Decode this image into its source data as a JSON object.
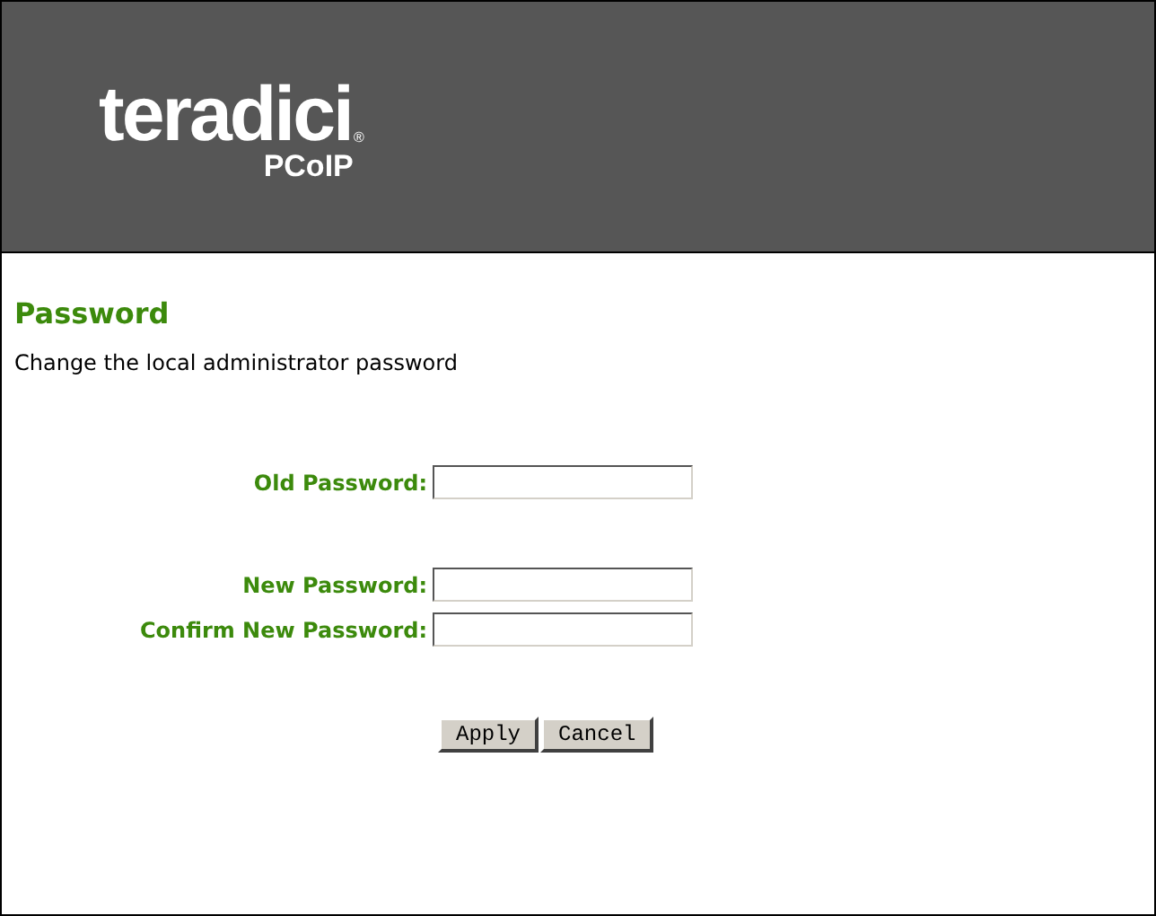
{
  "header": {
    "logo": {
      "brand": "teradici",
      "mark": "®",
      "product": "PCoIP"
    }
  },
  "page": {
    "title": "Password",
    "description": "Change the local administrator password"
  },
  "field_groups": [
    [
      {
        "label": "Old Password:"
      }
    ],
    [
      {
        "label": "New Password:"
      },
      {
        "label": "Confirm New Password:"
      }
    ]
  ],
  "buttons": [
    "Apply",
    "Cancel"
  ]
}
